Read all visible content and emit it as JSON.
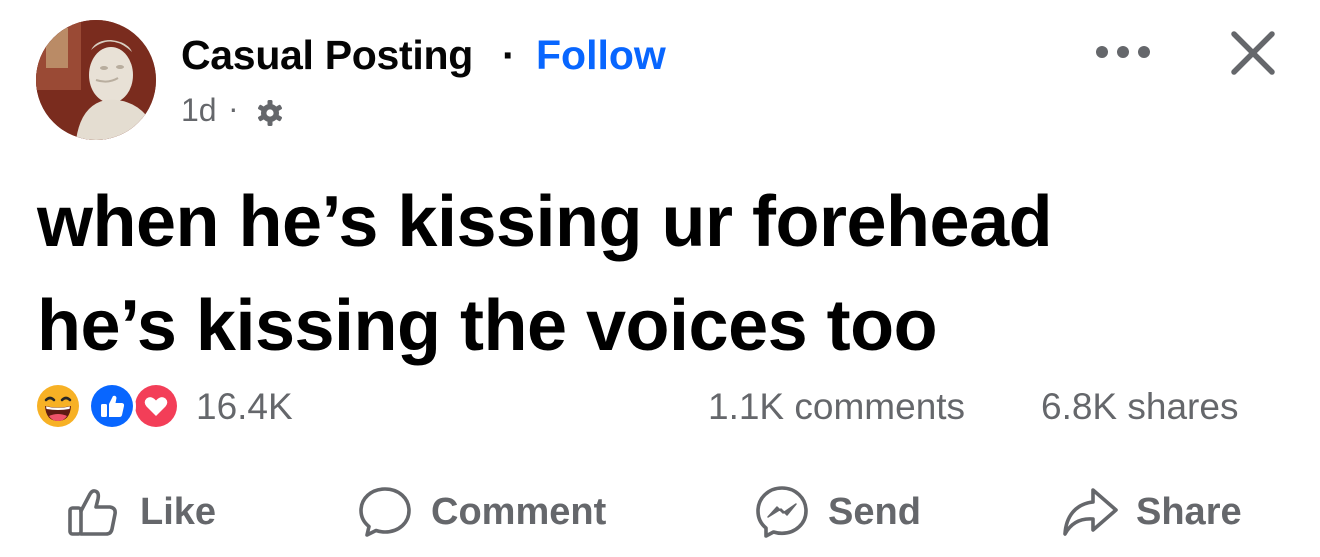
{
  "post": {
    "page_name": "Casual Posting",
    "separator": "·",
    "follow_label": "Follow",
    "time": "1d",
    "meta_separator": "·",
    "text_lines": [
      "when he’s kissing ur forehead",
      "he’s kissing the voices too"
    ]
  },
  "engagement": {
    "reaction_count": "16.4K",
    "reactions": [
      "haha-icon",
      "like-icon",
      "love-icon"
    ],
    "comments": "1.1K comments",
    "shares": "6.8K shares"
  },
  "actions": {
    "like": "Like",
    "comment": "Comment",
    "send": "Send",
    "share": "Share"
  },
  "colors": {
    "accent": "#0866ff",
    "secondary_text": "#65676b",
    "love": "#f33e58",
    "haha": "#f7b125"
  }
}
